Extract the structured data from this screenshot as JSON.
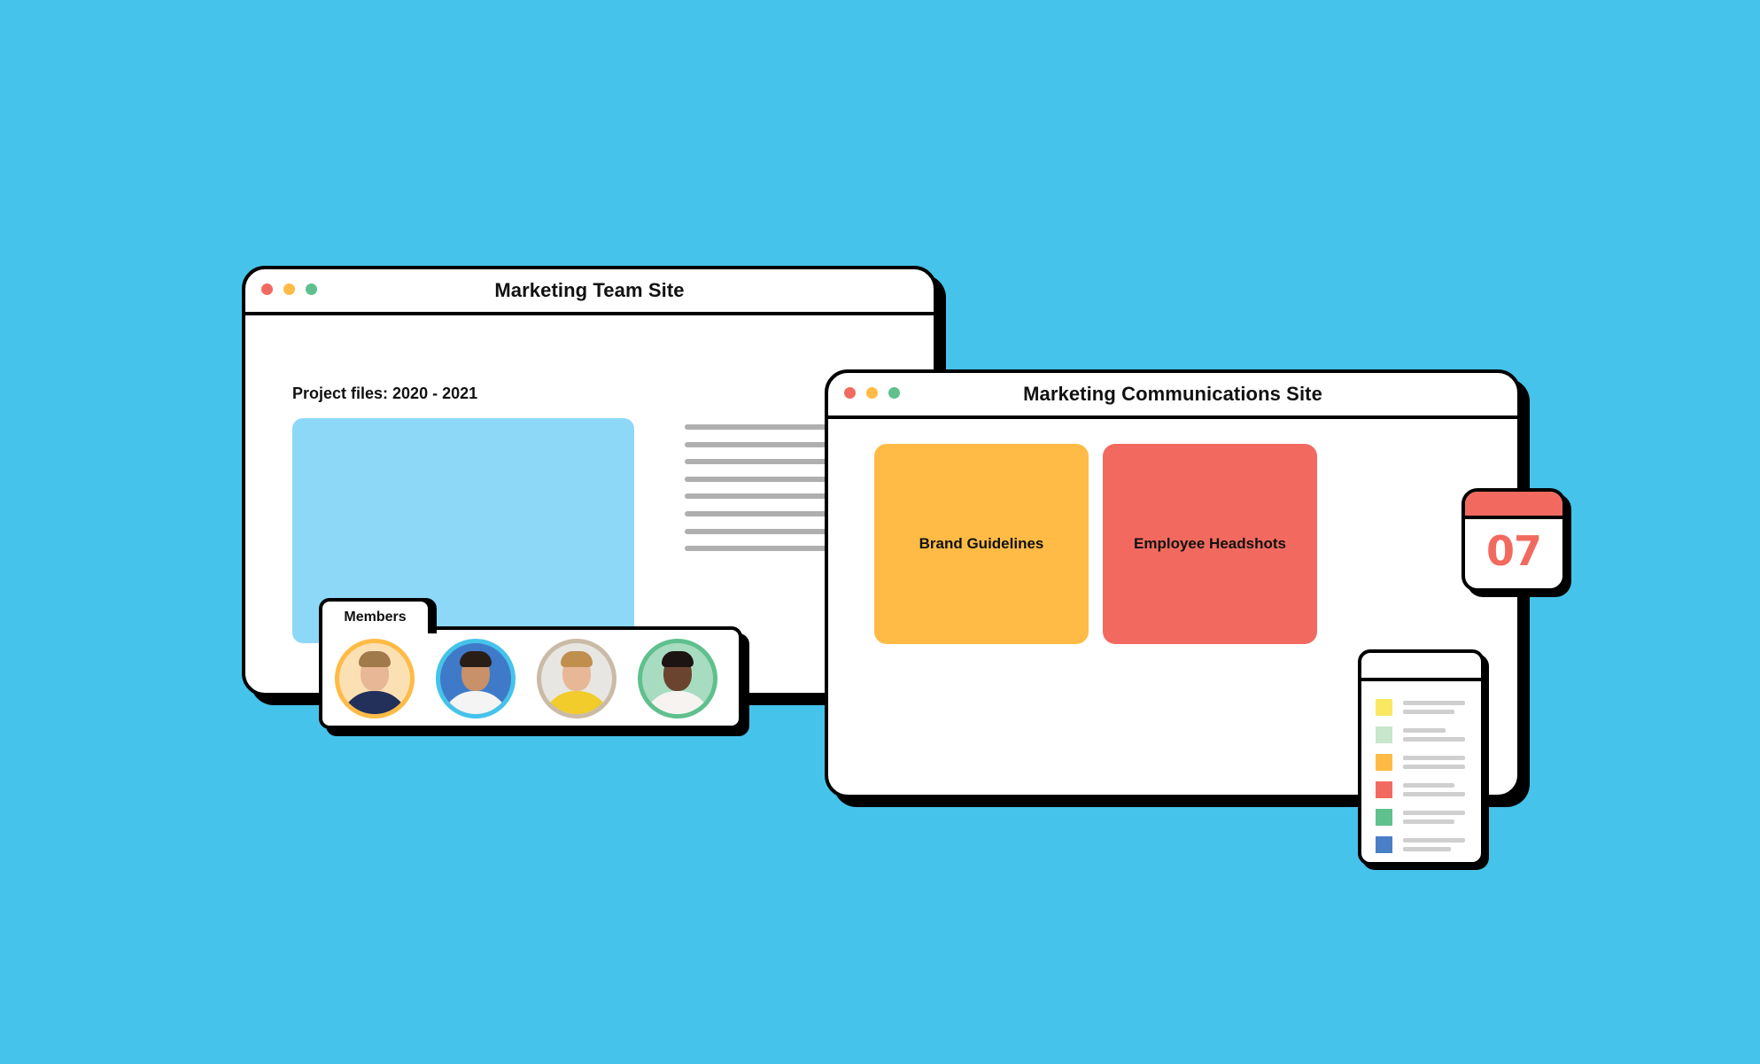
{
  "background_color": "#45c3ea",
  "window_controls": {
    "close_color": "#f26a5f",
    "minimize_color": "#ffbb45",
    "maximize_color": "#5fc08d"
  },
  "team_site_window": {
    "title": "Marketing Team Site",
    "project_label": "Project files: 2020 - 2021",
    "preview_color": "#8dd8f7",
    "text_line_count": 8
  },
  "members_panel": {
    "tab_label": "Members",
    "avatars": [
      {
        "name": "member-1",
        "ring_color": "#ffbb45",
        "bg_color": "#fbe0b4",
        "shirt_color": "#22305a",
        "hair_color": "#a07a4a"
      },
      {
        "name": "member-2",
        "ring_color": "#45c3ea",
        "bg_color": "#3f7ac9",
        "shirt_color": "#f4f4f4",
        "hair_color": "#2a1d16"
      },
      {
        "name": "member-3",
        "ring_color": "#c9bba6",
        "bg_color": "#e8e6e2",
        "shirt_color": "#f1cc2a",
        "hair_color": "#c08f4e"
      },
      {
        "name": "member-4",
        "ring_color": "#5fc08d",
        "bg_color": "#a7dcc0",
        "shirt_color": "#f7f3f0",
        "hair_color": "#1c1412"
      }
    ]
  },
  "comms_site_window": {
    "title": "Marketing Communications Site",
    "tiles": [
      {
        "label": "Brand Guidelines",
        "color": "#ffbb45"
      },
      {
        "label": "Employee Headshots",
        "color": "#f26a5f"
      }
    ]
  },
  "calendar": {
    "day": "07",
    "accent_color": "#f26a5f"
  },
  "list_card": {
    "items": [
      {
        "swatch_color": "#fbe862"
      },
      {
        "swatch_color": "#c7e6cb"
      },
      {
        "swatch_color": "#ffbb45"
      },
      {
        "swatch_color": "#f26a5f"
      },
      {
        "swatch_color": "#5fc08d"
      },
      {
        "swatch_color": "#4a7fc6"
      }
    ]
  }
}
